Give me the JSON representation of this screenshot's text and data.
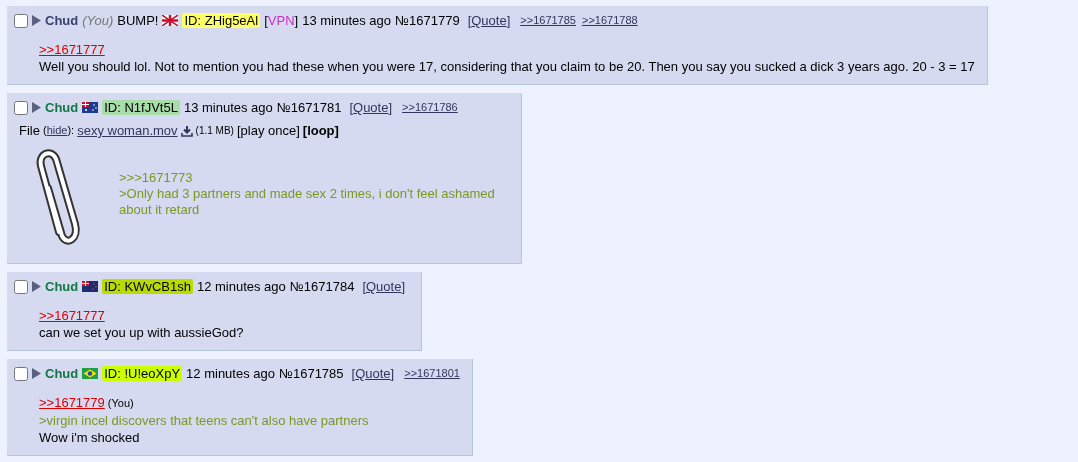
{
  "posts": [
    {
      "checked": false,
      "name": "Chud",
      "you_label": "(You)",
      "subject": "BUMP!",
      "flag": {
        "kind": "uk"
      },
      "id": "ID: ZHig5eAl",
      "color": "#ffff66",
      "vpn": "[VPN]",
      "time": "13 minutes ago",
      "number": "№1671779",
      "quote": "[Quote]",
      "backlinks": [
        ">>1671785",
        ">>1671788"
      ],
      "body": [
        {
          "kind": "quotelink",
          "text": ">>1671777"
        },
        {
          "kind": "text",
          "text": "Well you should lol. Not to mention you had these when you were 17, considering that you claim to be 20. Then you say you sucked a dick 3 years ago. 20 - 3 = 17"
        }
      ]
    },
    {
      "checked": false,
      "name": "Chud",
      "flag": {
        "kind": "au"
      },
      "id": "ID: N1fJVt5L",
      "color": "#a8dca8",
      "time": "13 minutes ago",
      "number": "№1671781",
      "quote": "[Quote]",
      "backlinks": [
        ">>1671786"
      ],
      "file": {
        "label": "File",
        "hide": "(hide):",
        "filename": "sexy woman.mov",
        "size": "(1.1 MB)",
        "play_once": "[play once]",
        "loop": "[loop]"
      },
      "body": [
        {
          "kind": "greentext",
          "text": ">>>1671773"
        },
        {
          "kind": "greentext",
          "text": ">Only had 3 partners and made sex 2 times, i don't feel ashamed about it retard"
        }
      ]
    },
    {
      "checked": false,
      "name": "Chud",
      "flag": {
        "kind": "nz"
      },
      "id": "ID: KWvCB1sh",
      "color": "#b8dc00",
      "time": "12 minutes ago",
      "number": "№1671784",
      "quote": "[Quote]",
      "body": [
        {
          "kind": "quotelink",
          "text": ">>1671777"
        },
        {
          "kind": "text",
          "text": "can we set you up with aussieGod?"
        }
      ]
    },
    {
      "checked": false,
      "name": "Chud",
      "flag": {
        "kind": "br"
      },
      "id": "ID: !U!eoXpY",
      "color": "#ccff00",
      "time": "12 minutes ago",
      "number": "№1671785",
      "quote": "[Quote]",
      "backlinks": [
        ">>1671801"
      ],
      "body": [
        {
          "kind": "quotelink",
          "text": ">>1671779",
          "you_mark": "(You)"
        },
        {
          "kind": "greentext",
          "text": ">virgin incel discovers that teens can't also have partners"
        },
        {
          "kind": "text",
          "text": "Wow i'm shocked"
        }
      ]
    }
  ]
}
